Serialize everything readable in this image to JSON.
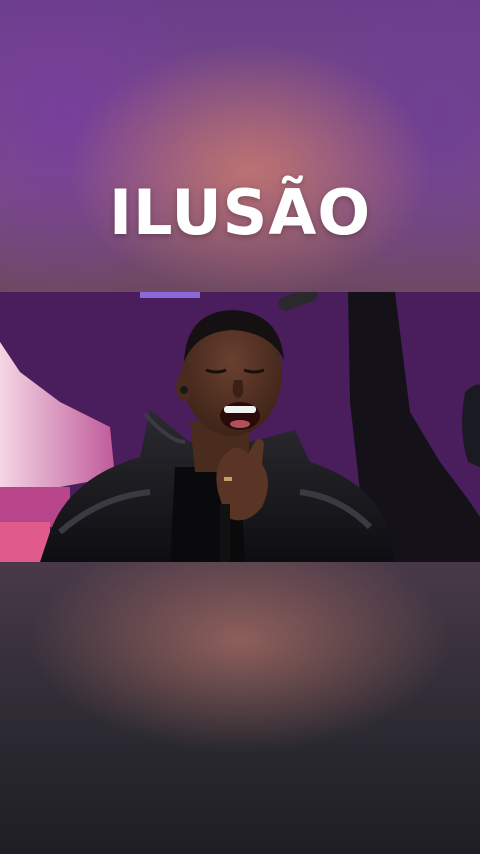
{
  "overlay": {
    "title": "ILUSÃO"
  },
  "video": {
    "subject": "singer-performing"
  },
  "colors": {
    "title_text": "#ffffff",
    "stage_purple": "#5a2670",
    "jacket_black": "#121216"
  }
}
